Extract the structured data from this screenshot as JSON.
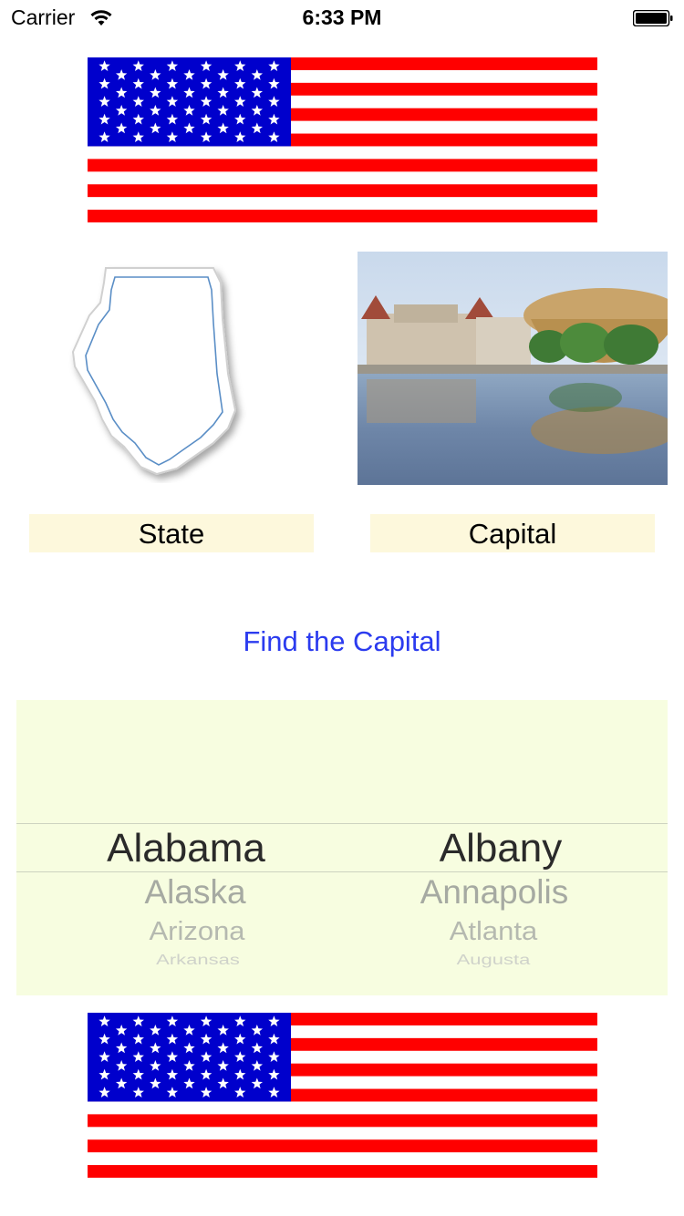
{
  "status_bar": {
    "carrier": "Carrier",
    "time": "6:33 PM",
    "wifi_icon": "wifi-icon",
    "battery_icon": "battery-icon"
  },
  "flag_icon": "us-flag-icon",
  "state_image": "state-outline-icon",
  "capital_image": "capitol-building-photo",
  "labels": {
    "state": "State",
    "capital": "Capital"
  },
  "find_button": "Find the Capital",
  "picker": {
    "states": [
      "Alabama",
      "Alaska",
      "Arizona",
      "Arkansas"
    ],
    "capitals": [
      "Albany",
      "Annapolis",
      "Atlanta",
      "Augusta"
    ]
  },
  "colors": {
    "flag_red": "#ff0000",
    "flag_blue": "#0000cc",
    "label_bg": "#fdf8dc",
    "picker_bg": "#f7fde0",
    "button_text": "#2b3bef"
  }
}
